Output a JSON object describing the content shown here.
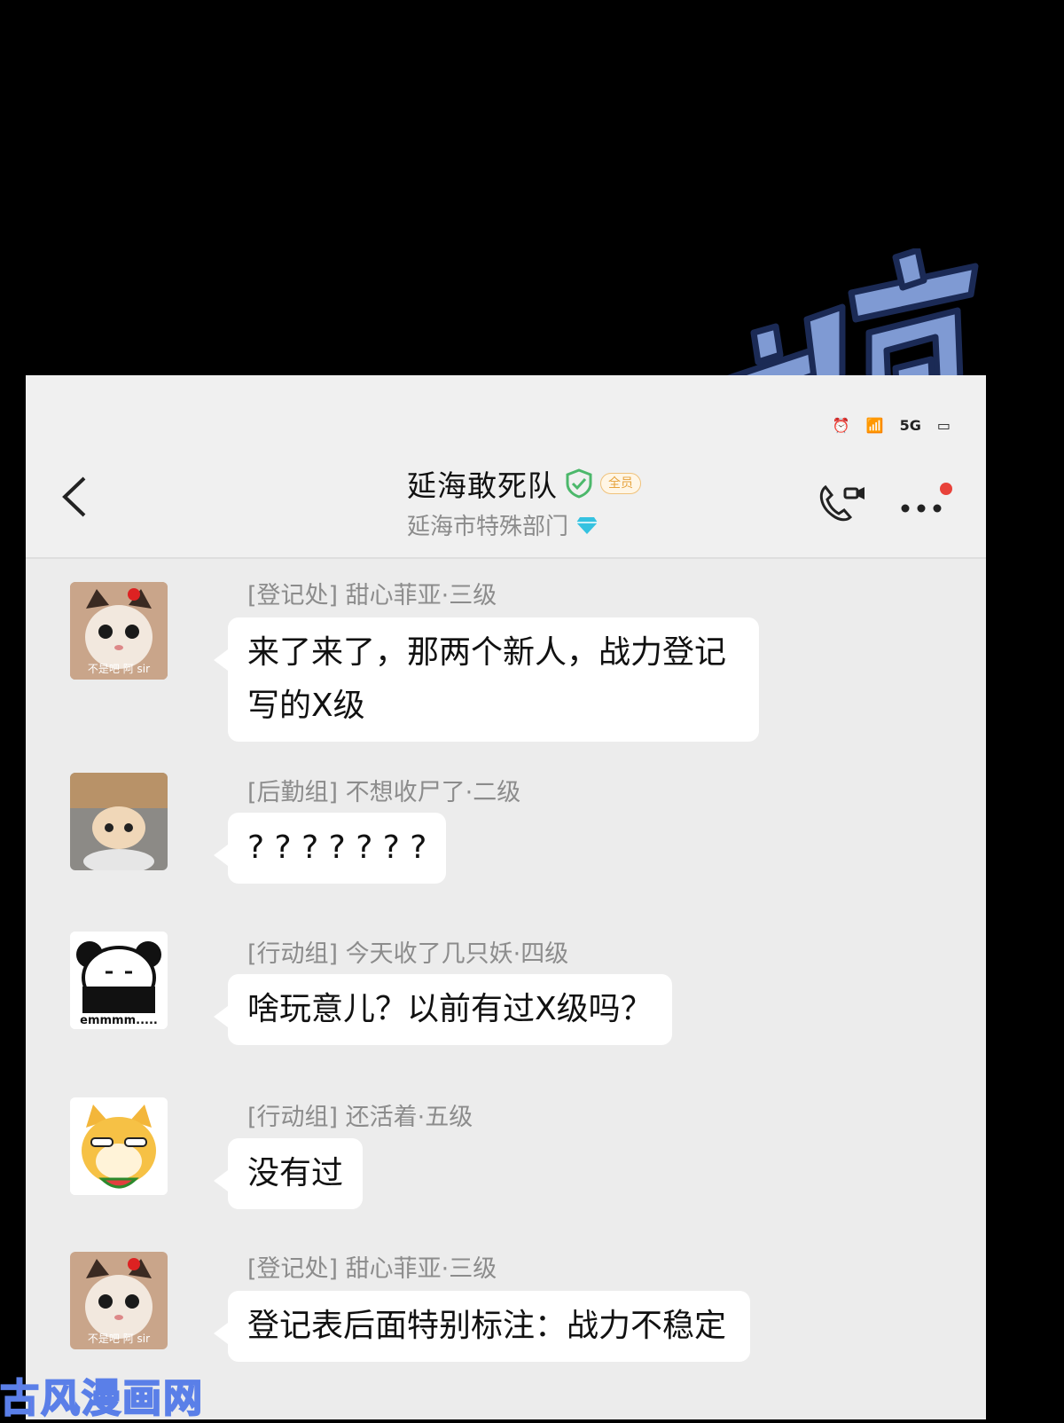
{
  "status_bar": {
    "network_label": "5G"
  },
  "header": {
    "title": "延海敢死队",
    "badge": "全员",
    "subtitle": "延海市特殊部门"
  },
  "messages": [
    {
      "sender": "[登记处] 甜心菲亚·三级",
      "text": "来了来了，那两个新人，战力登记写的X级",
      "avatar_caption": "不是吧 阿 sir"
    },
    {
      "sender": "[后勤组] 不想收尸了·二级",
      "text": "? ? ? ? ? ? ?",
      "avatar_caption": ""
    },
    {
      "sender": "[行动组] 今天收了几只妖·四级",
      "text": "啥玩意儿？以前有过X级吗？",
      "avatar_caption": "emmmm....."
    },
    {
      "sender": "[行动组] 还活着·五级",
      "text": "没有过",
      "avatar_caption": ""
    },
    {
      "sender": "[登记处] 甜心菲亚·三级",
      "text": "登记表后面特别标注：战力不稳定",
      "avatar_caption": "不是吧 阿 sir"
    }
  ],
  "sound_effect": "嘀嘀",
  "watermark": "古风漫画网",
  "colors": {
    "bubble": "#ffffff",
    "background": "#ececec",
    "accent_green": "#4cb86b",
    "diamond": "#35c2e0",
    "notification_dot": "#e8423a"
  }
}
